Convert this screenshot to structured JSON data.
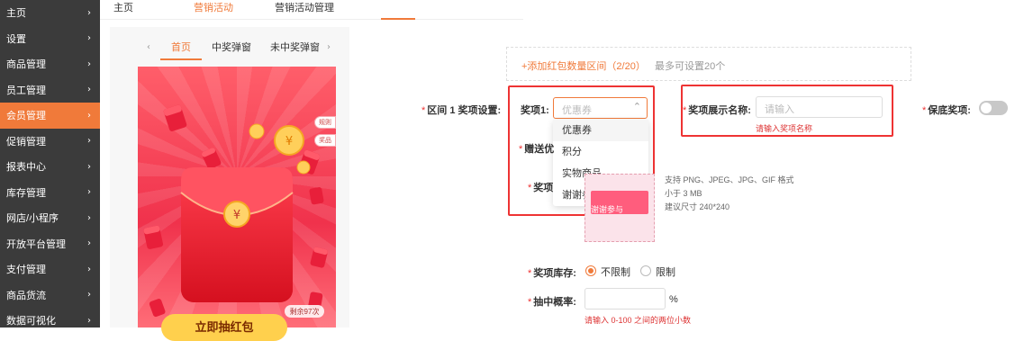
{
  "sidebar": {
    "items": [
      {
        "label": "主页"
      },
      {
        "label": "设置"
      },
      {
        "label": "商品管理"
      },
      {
        "label": "员工管理"
      },
      {
        "label": "会员管理",
        "active": true
      },
      {
        "label": "促销管理"
      },
      {
        "label": "报表中心"
      },
      {
        "label": "库存管理"
      },
      {
        "label": "网店/小程序"
      },
      {
        "label": "开放平台管理"
      },
      {
        "label": "支付管理"
      },
      {
        "label": "商品货流"
      },
      {
        "label": "数据可视化"
      }
    ],
    "chevron": "›"
  },
  "topnav": {
    "tabs": [
      {
        "label": "主页"
      },
      {
        "label": "营销活动",
        "active": true
      },
      {
        "label": "营销活动管理"
      }
    ]
  },
  "preview": {
    "prev_arrow": "‹",
    "next_arrow": "›",
    "tabs": [
      {
        "label": "首页",
        "active": true
      },
      {
        "label": "中奖弹窗"
      },
      {
        "label": "未中奖弹窗"
      }
    ],
    "badge_rules": "规则",
    "badge_prizes": "奖品",
    "remaining": "剩余97次",
    "draw_button": "立即抽红包"
  },
  "form": {
    "add_range_link": "+添加红包数量区间（2/20）",
    "add_range_hint": "最多可设置20个",
    "range_label": "区间 1 奖项设置:",
    "prize1_label": "奖项1:",
    "prize1_placeholder": "优惠券",
    "prize_type_options": [
      "优惠券",
      "积分",
      "实物商品",
      "谢谢参与"
    ],
    "display_name_label": "奖项展示名称:",
    "display_name_placeholder": "请输入",
    "display_name_error": "请输入奖项名称",
    "guarantee_label": "保底奖项:",
    "gift_label_partial": "赠送优",
    "image_label_partial": "奖项",
    "upload_image_text": "谢谢参与",
    "upload_notes": [
      "支持 PNG、JPEG、JPG、GIF 格式",
      "小于 3 MB",
      "建议尺寸 240*240"
    ],
    "stock_label": "奖项库存:",
    "stock_unlimited": "不限制",
    "stock_limited": "限制",
    "probability_label": "抽中概率:",
    "probability_unit": "%",
    "probability_error": "请输入 0-100 之间的两位小数"
  },
  "colors": {
    "accent": "#f07a3a",
    "error": "#e33333",
    "sidebar_bg": "#3b3b3b"
  }
}
